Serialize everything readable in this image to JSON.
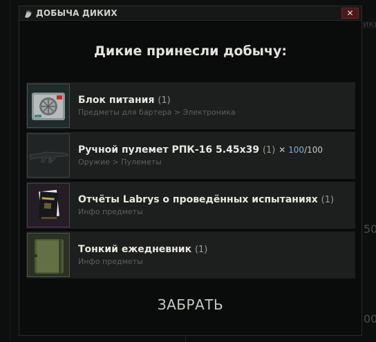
{
  "window": {
    "title": "ДОБЫЧА ДИКИХ",
    "close_glyph": "✕"
  },
  "heading": "Дикие принесли добычу:",
  "items": [
    {
      "name": "Блок питания",
      "count": "(1)",
      "category": "Предметы для бартера > Электроника",
      "icon": "power-supply-icon"
    },
    {
      "name": "Ручной пулемет РПК-16 5.45x39",
      "count": "(1)",
      "durability_current": "100",
      "durability_max": "/100",
      "category": "Оружие > Пулеметы",
      "icon": "rpk16-rifle-icon"
    },
    {
      "name": "Отчёты Labrys о проведённых испытаниях",
      "count": "(1)",
      "category": "Инфо предметы",
      "icon": "labrys-report-icon"
    },
    {
      "name": "Тонкий ежедневник",
      "count": "(1)",
      "category": "Инфо предметы",
      "icon": "diary-icon"
    }
  ],
  "take_button": "ЗАБРАТЬ",
  "background_fragments": {
    "right_top": "ики",
    "right_mid": "50",
    "right_bottom": "00"
  },
  "colors": {
    "close_button": "#4a1a1a",
    "durability_current": "#8aa8d8"
  }
}
